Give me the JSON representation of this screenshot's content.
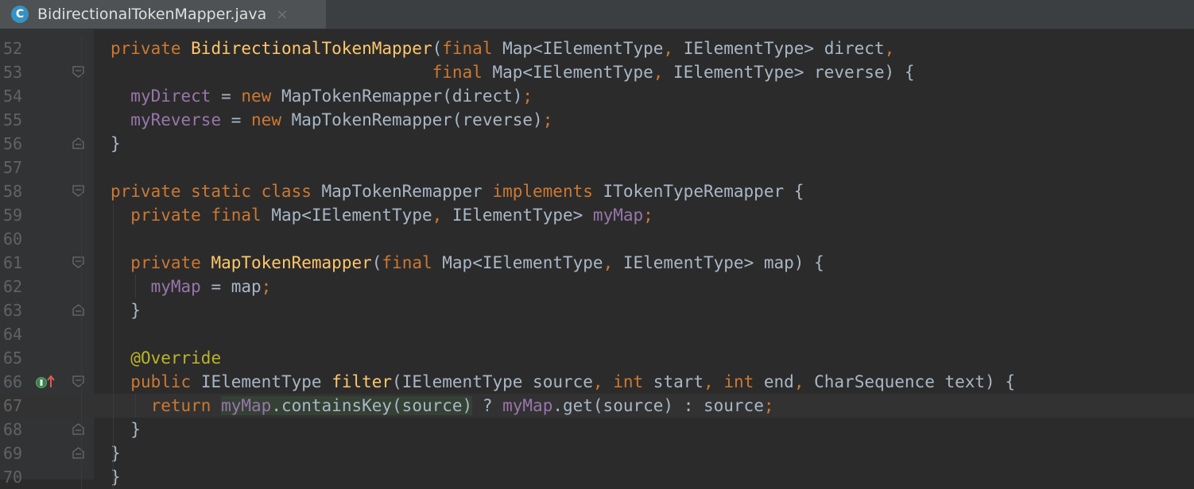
{
  "tab": {
    "icon_letter": "C",
    "title": "BidirectionalTokenMapper.java",
    "close_glyph": "×"
  },
  "lines": [
    {
      "num": "52",
      "tokens": [
        {
          "t": "private ",
          "c": "kw"
        },
        {
          "t": "BidirectionalTokenMapper",
          "c": "fn"
        },
        {
          "t": "(",
          "c": ""
        },
        {
          "t": "final ",
          "c": "kw"
        },
        {
          "t": "Map<IElementType",
          "c": ""
        },
        {
          "t": ", ",
          "c": "kw"
        },
        {
          "t": "IElementType> direct",
          "c": ""
        },
        {
          "t": ",",
          "c": "kw"
        }
      ]
    },
    {
      "num": "53",
      "tokens": [
        {
          "t": "                                ",
          "c": ""
        },
        {
          "t": "final ",
          "c": "kw"
        },
        {
          "t": "Map<IElementType",
          "c": ""
        },
        {
          "t": ", ",
          "c": "kw"
        },
        {
          "t": "IElementType> reverse) {",
          "c": ""
        }
      ]
    },
    {
      "num": "54",
      "tokens": [
        {
          "t": "  ",
          "c": ""
        },
        {
          "t": "myDirect",
          "c": "fld"
        },
        {
          "t": " = ",
          "c": ""
        },
        {
          "t": "new ",
          "c": "kw"
        },
        {
          "t": "MapTokenRemapper(direct)",
          "c": ""
        },
        {
          "t": ";",
          "c": "kw"
        }
      ]
    },
    {
      "num": "55",
      "tokens": [
        {
          "t": "  ",
          "c": ""
        },
        {
          "t": "myReverse",
          "c": "fld"
        },
        {
          "t": " = ",
          "c": ""
        },
        {
          "t": "new ",
          "c": "kw"
        },
        {
          "t": "MapTokenRemapper(reverse)",
          "c": ""
        },
        {
          "t": ";",
          "c": "kw"
        }
      ]
    },
    {
      "num": "56",
      "tokens": [
        {
          "t": "}",
          "c": ""
        }
      ]
    },
    {
      "num": "57",
      "tokens": []
    },
    {
      "num": "58",
      "tokens": [
        {
          "t": "private static class ",
          "c": "kw"
        },
        {
          "t": "MapTokenRemapper ",
          "c": ""
        },
        {
          "t": "implements ",
          "c": "kw"
        },
        {
          "t": "ITokenTypeRemapper {",
          "c": ""
        }
      ]
    },
    {
      "num": "59",
      "tokens": [
        {
          "t": "  ",
          "c": ""
        },
        {
          "t": "private final ",
          "c": "kw"
        },
        {
          "t": "Map<IElementType",
          "c": ""
        },
        {
          "t": ", ",
          "c": "kw"
        },
        {
          "t": "IElementType> ",
          "c": ""
        },
        {
          "t": "myMap",
          "c": "fld"
        },
        {
          "t": ";",
          "c": "kw"
        }
      ]
    },
    {
      "num": "60",
      "tokens": []
    },
    {
      "num": "61",
      "tokens": [
        {
          "t": "  ",
          "c": ""
        },
        {
          "t": "private ",
          "c": "kw"
        },
        {
          "t": "MapTokenRemapper",
          "c": "fn"
        },
        {
          "t": "(",
          "c": ""
        },
        {
          "t": "final ",
          "c": "kw"
        },
        {
          "t": "Map<IElementType",
          "c": ""
        },
        {
          "t": ", ",
          "c": "kw"
        },
        {
          "t": "IElementType> map) {",
          "c": ""
        }
      ]
    },
    {
      "num": "62",
      "tokens": [
        {
          "t": "    ",
          "c": ""
        },
        {
          "t": "myMap",
          "c": "fld"
        },
        {
          "t": " = map",
          "c": ""
        },
        {
          "t": ";",
          "c": "kw"
        }
      ]
    },
    {
      "num": "63",
      "tokens": [
        {
          "t": "  }",
          "c": ""
        }
      ]
    },
    {
      "num": "64",
      "tokens": []
    },
    {
      "num": "65",
      "tokens": [
        {
          "t": "  ",
          "c": ""
        },
        {
          "t": "@Override",
          "c": "ann"
        }
      ]
    },
    {
      "num": "66",
      "tokens": [
        {
          "t": "  ",
          "c": ""
        },
        {
          "t": "public ",
          "c": "kw"
        },
        {
          "t": "IElementType ",
          "c": ""
        },
        {
          "t": "filter",
          "c": "fn"
        },
        {
          "t": "(IElementType source",
          "c": ""
        },
        {
          "t": ", ",
          "c": "kw"
        },
        {
          "t": "int ",
          "c": "kw"
        },
        {
          "t": "start",
          "c": ""
        },
        {
          "t": ", ",
          "c": "kw"
        },
        {
          "t": "int ",
          "c": "kw"
        },
        {
          "t": "end",
          "c": ""
        },
        {
          "t": ", ",
          "c": "kw"
        },
        {
          "t": "CharSequence text) {",
          "c": ""
        }
      ]
    },
    {
      "num": "67",
      "current": true,
      "tokens": [
        {
          "t": "    ",
          "c": ""
        },
        {
          "t": "return ",
          "c": "kw"
        },
        {
          "t": "myMap",
          "c": "fld hl"
        },
        {
          "t": ".containsKey(source)",
          "c": "hl"
        },
        {
          "t": " ? ",
          "c": ""
        },
        {
          "t": "myMap",
          "c": "fld"
        },
        {
          "t": ".get(source) : source",
          "c": ""
        },
        {
          "t": ";",
          "c": "kw"
        }
      ]
    },
    {
      "num": "68",
      "tokens": [
        {
          "t": "  }",
          "c": ""
        }
      ]
    },
    {
      "num": "69",
      "tokens": [
        {
          "t": "}",
          "c": ""
        }
      ]
    },
    {
      "num": "70",
      "tokens": [
        {
          "t": "}",
          "c": ""
        }
      ]
    }
  ]
}
